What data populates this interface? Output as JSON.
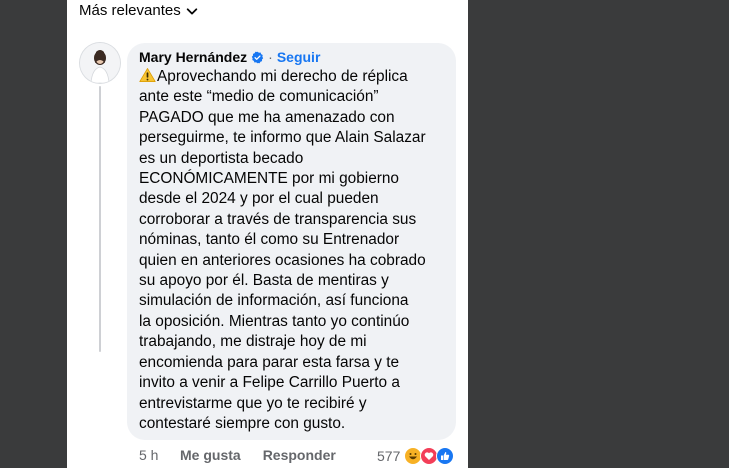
{
  "sort": {
    "label": "Más relevantes",
    "icon": "chevron-down-icon"
  },
  "comment": {
    "author": "Mary Hernández",
    "separator": "·",
    "follow_label": "Seguir",
    "icons": {
      "verified": "verified-badge-icon",
      "warning": "warning-icon"
    },
    "lines": [
      "Aprovechando mi derecho de réplica",
      "ante este “medio de comunicación”",
      "PAGADO que me ha amenazado con",
      "perseguirme, te informo que Alain Salazar",
      "es un deportista becado",
      "ECONÓMICAMENTE por mi gobierno",
      "desde el 2024 y por el cual pueden",
      "corroborar a través de transparencia sus",
      "nóminas, tanto él como su Entrenador",
      "quien en anteriores ocasiones ha cobrado",
      "su apoyo por él. Basta de mentiras y",
      "simulación de información, así funciona",
      "la oposición. Mientras tanto yo continúo",
      "trabajando, me distraje hoy de mi",
      "encomienda para parar esta farsa y te",
      "invito a venir a Felipe Carrillo Puerto a",
      "entrevistarme que yo te recibiré y",
      "contestaré siempre con gusto."
    ],
    "time": "5 h",
    "like_label": "Me gusta",
    "reply_label": "Responder",
    "reaction_count": "577",
    "reactions": [
      "haha-icon",
      "love-icon",
      "like-icon"
    ],
    "colors": {
      "link": "#1877f2",
      "bubble": "#f0f2f5",
      "muted": "#65676b"
    }
  }
}
